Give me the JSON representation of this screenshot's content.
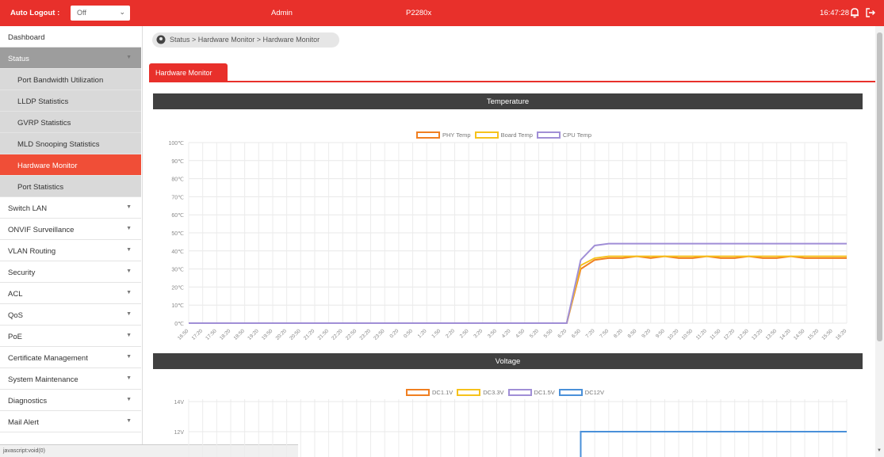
{
  "topbar": {
    "auto_logout_label": "Auto Logout :",
    "auto_logout_value": "Off",
    "user": "Admin",
    "model": "P2280x",
    "time": "16:47:28"
  },
  "sidebar": {
    "items": [
      {
        "label": "Dashboard",
        "kind": "top",
        "chevron": false
      },
      {
        "label": "Status",
        "kind": "group",
        "chevron": true
      },
      {
        "label": "Port Bandwidth Utilization",
        "kind": "sub"
      },
      {
        "label": "LLDP Statistics",
        "kind": "sub"
      },
      {
        "label": "GVRP Statistics",
        "kind": "sub"
      },
      {
        "label": "MLD Snooping Statistics",
        "kind": "sub"
      },
      {
        "label": "Hardware Monitor",
        "kind": "active"
      },
      {
        "label": "Port Statistics",
        "kind": "sub"
      },
      {
        "label": "Switch LAN",
        "kind": "top",
        "chevron": true
      },
      {
        "label": "ONVIF Surveillance",
        "kind": "top",
        "chevron": true
      },
      {
        "label": "VLAN Routing",
        "kind": "top",
        "chevron": true
      },
      {
        "label": "Security",
        "kind": "top",
        "chevron": true
      },
      {
        "label": "ACL",
        "kind": "top",
        "chevron": true
      },
      {
        "label": "QoS",
        "kind": "top",
        "chevron": true
      },
      {
        "label": "PoE",
        "kind": "top",
        "chevron": true
      },
      {
        "label": "Certificate Management",
        "kind": "top",
        "chevron": true
      },
      {
        "label": "System Maintenance",
        "kind": "top",
        "chevron": true
      },
      {
        "label": "Diagnostics",
        "kind": "top",
        "chevron": true
      },
      {
        "label": "Mail Alert",
        "kind": "top",
        "chevron": true
      }
    ]
  },
  "status_bar": "javascript:void(0)",
  "breadcrumb": "Status > Hardware Monitor > Hardware Monitor",
  "tab_label": "Hardware Monitor",
  "sections": {
    "temperature": "Temperature",
    "voltage": "Voltage"
  },
  "colors": {
    "brand_red": "#e8302b",
    "phy": "#f07f21",
    "board": "#f6c21c",
    "cpu": "#a08ed6",
    "dc11": "#f07f21",
    "dc33": "#f6c21c",
    "dc15": "#a08ed6",
    "dc12": "#4a90d9"
  },
  "chart_data": [
    {
      "type": "line",
      "title": "Temperature",
      "ylim": [
        0,
        100
      ],
      "y_ticks": [
        "0℃",
        "10℃",
        "20℃",
        "30℃",
        "40℃",
        "50℃",
        "60℃",
        "70℃",
        "80℃",
        "90℃",
        "100℃"
      ],
      "x": [
        "16:50",
        "17:20",
        "17:50",
        "18:20",
        "18:50",
        "19:20",
        "19:50",
        "20:20",
        "20:50",
        "21:20",
        "21:50",
        "22:20",
        "22:50",
        "23:20",
        "23:50",
        "0:20",
        "0:50",
        "1:20",
        "1:50",
        "2:20",
        "2:50",
        "3:20",
        "3:50",
        "4:20",
        "4:50",
        "5:20",
        "5:50",
        "6:20",
        "6:50",
        "7:20",
        "7:50",
        "8:20",
        "8:50",
        "9:20",
        "9:50",
        "10:20",
        "10:50",
        "11:20",
        "11:50",
        "12:20",
        "12:50",
        "13:20",
        "13:50",
        "14:20",
        "14:50",
        "15:20",
        "15:50",
        "16:20"
      ],
      "grid": true,
      "legend_position": "top-center",
      "series": [
        {
          "name": "PHY Temp",
          "values": [
            0,
            0,
            0,
            0,
            0,
            0,
            0,
            0,
            0,
            0,
            0,
            0,
            0,
            0,
            0,
            0,
            0,
            0,
            0,
            0,
            0,
            0,
            0,
            0,
            0,
            0,
            0,
            0,
            30,
            35,
            36,
            36,
            37,
            36,
            37,
            36,
            36,
            37,
            36,
            36,
            37,
            36,
            36,
            37,
            36,
            36,
            36,
            36
          ]
        },
        {
          "name": "Board Temp",
          "values": [
            0,
            0,
            0,
            0,
            0,
            0,
            0,
            0,
            0,
            0,
            0,
            0,
            0,
            0,
            0,
            0,
            0,
            0,
            0,
            0,
            0,
            0,
            0,
            0,
            0,
            0,
            0,
            0,
            32,
            36,
            37,
            37,
            37,
            37,
            37,
            37,
            37,
            37,
            37,
            37,
            37,
            37,
            37,
            37,
            37,
            37,
            37,
            37
          ]
        },
        {
          "name": "CPU Temp",
          "values": [
            0,
            0,
            0,
            0,
            0,
            0,
            0,
            0,
            0,
            0,
            0,
            0,
            0,
            0,
            0,
            0,
            0,
            0,
            0,
            0,
            0,
            0,
            0,
            0,
            0,
            0,
            0,
            0,
            35,
            43,
            44,
            44,
            44,
            44,
            44,
            44,
            44,
            44,
            44,
            44,
            44,
            44,
            44,
            44,
            44,
            44,
            44,
            44
          ]
        }
      ]
    },
    {
      "type": "line",
      "title": "Voltage",
      "y_ticks_visible": [
        "12V",
        "14V"
      ],
      "legend_position": "top-center",
      "series": [
        {
          "name": "DC1.1V"
        },
        {
          "name": "DC3.3V"
        },
        {
          "name": "DC1.5V"
        },
        {
          "name": "DC12V",
          "visible_value": 12
        }
      ]
    }
  ]
}
